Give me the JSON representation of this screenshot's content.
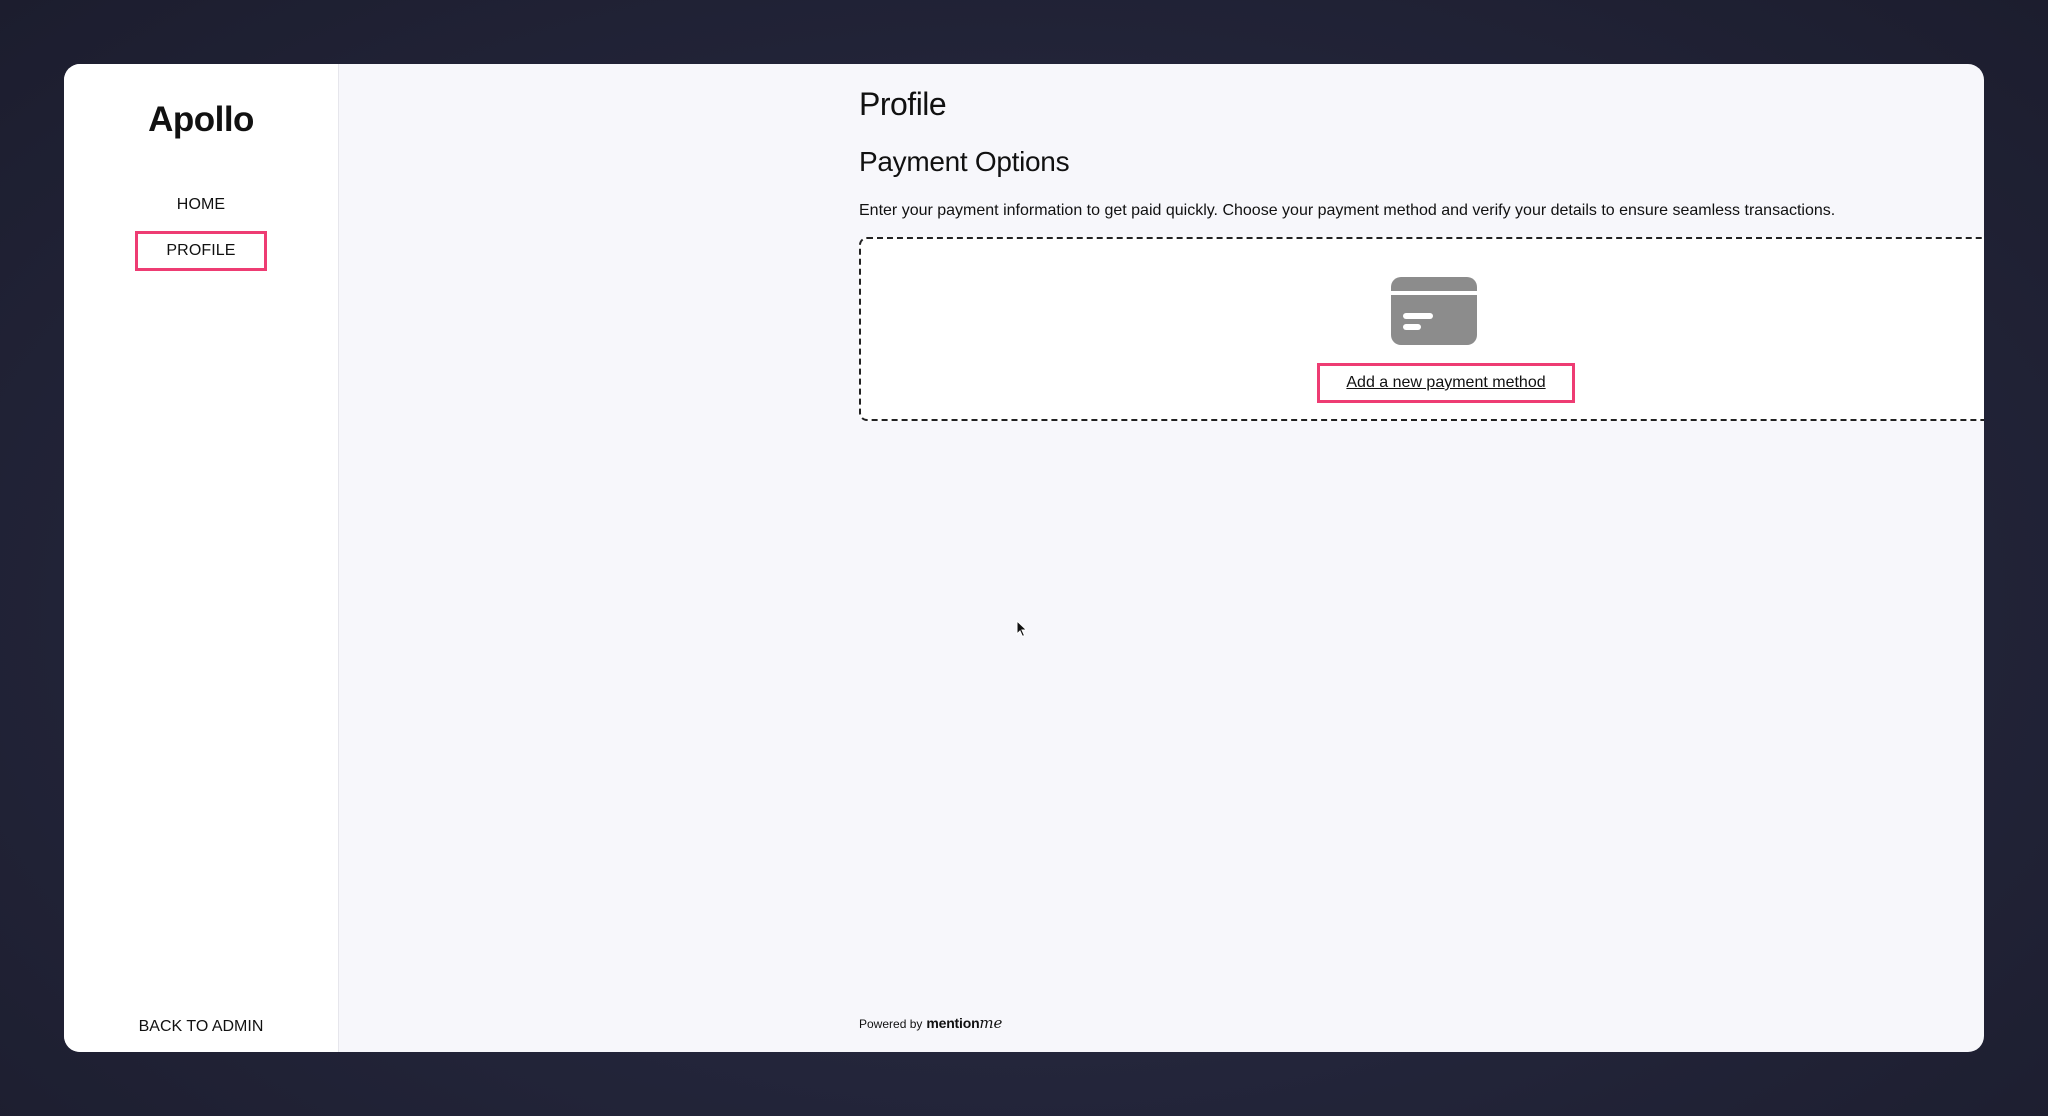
{
  "app": {
    "logo": "Apollo"
  },
  "sidebar": {
    "items": [
      {
        "label": "HOME",
        "active": false
      },
      {
        "label": "PROFILE",
        "active": true
      }
    ],
    "back_label": "BACK TO ADMIN"
  },
  "main": {
    "page_title": "Profile",
    "section_title": "Payment Options",
    "description": "Enter your payment information to get paid quickly. Choose your payment method and verify your details to ensure seamless transactions.",
    "payment_box": {
      "icon": "credit-card-icon",
      "add_label": "Add a new payment method"
    }
  },
  "footer": {
    "powered_prefix": "Powered by",
    "brand_bold": "mention",
    "brand_script": "me"
  },
  "colors": {
    "highlight": "#ee3c73",
    "background": "#23253a",
    "panel": "#f7f7fb",
    "icon_gray": "#8c8c8c"
  }
}
